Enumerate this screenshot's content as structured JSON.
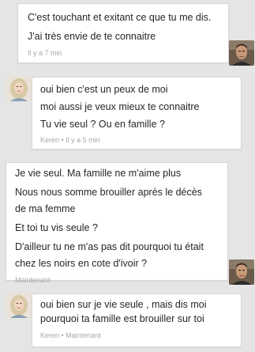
{
  "messages": [
    {
      "sender": "me",
      "lines": [
        "C'est touchant et exitant ce que tu me dis.",
        "J'ai très envie de te connaitre"
      ],
      "meta": "Il y a 7 min"
    },
    {
      "sender": "Keren",
      "lines": [
        "oui bien c'est un peux de moi",
        "moi aussi je veux mieux te connaitre",
        "Tu vie seul ? Ou en famille ?"
      ],
      "meta": "Keren • Il y a 5 min"
    },
    {
      "sender": "me",
      "paragraphs": [
        [
          "Je vie seul. Ma famille ne m'aime plus"
        ],
        [
          "Nous nous somme brouiller après le décès",
          "de ma femme"
        ],
        [
          "Et toi tu vis seule ?"
        ],
        [
          "D'ailleur tu ne m'as pas dit pourquoi tu était",
          "chez les noirs en cote d'ivoir ?"
        ]
      ],
      "meta": "Maintenant"
    },
    {
      "sender": "Keren",
      "lines": [
        "oui bien sur je vie seule , mais dis moi",
        "pourquoi ta famille est brouiller sur toi"
      ],
      "meta": "Keren • Maintenant"
    }
  ],
  "colors": {
    "background": "#e5e5e5",
    "bubble": "#ffffff",
    "meta_text": "#a8a8a8"
  },
  "icons": {
    "me_avatar": "man-portrait-avatar",
    "keren_avatar": "woman-portrait-avatar"
  }
}
